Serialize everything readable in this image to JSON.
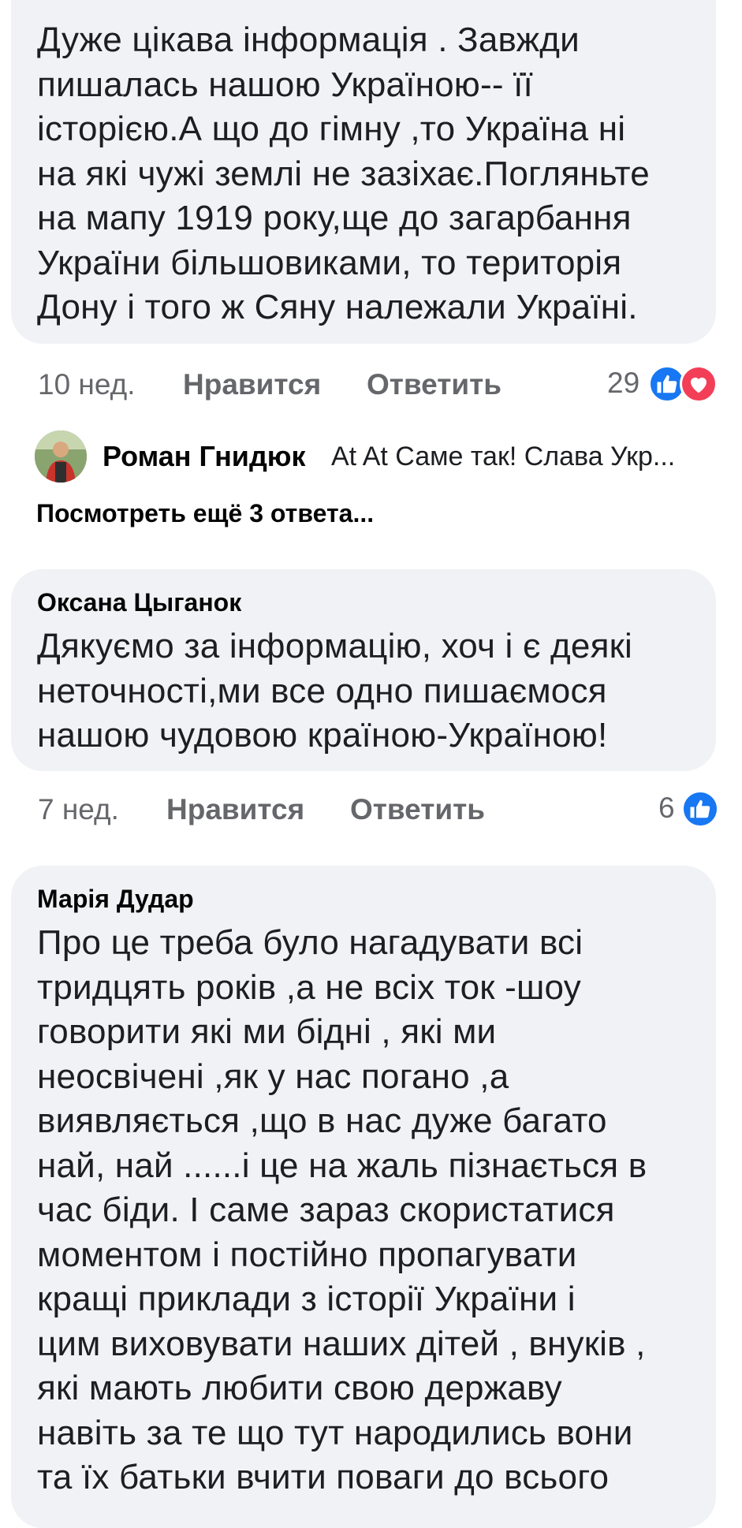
{
  "comment1": {
    "text_lines": [
      "Дуже цікава інформація . Завжди",
      "пишалась нашою Україною-- її",
      "історією.А що до гімну ,то Україна ні",
      "на які чужі землі не зазіхає.Погляньте",
      "на мапу 1919 року,ще до загарбання",
      "України більшовиками, то територія",
      "Дону і того ж Сяну належали Україні."
    ],
    "time": "10 нед.",
    "like_label": "Нравится",
    "reply_label": "Ответить",
    "reaction_count": "29",
    "reactions": [
      "like-icon",
      "love-icon"
    ]
  },
  "reply_preview": {
    "author": "Роман Гнидюк",
    "snippet": "At At Саме так! Слава Укр...",
    "more_label": "Посмотреть ещё 3 ответа..."
  },
  "comment2": {
    "author": "Оксана Цыганок",
    "text_lines": [
      "Дякуємо за інформацію, хоч і є деякі",
      "неточності,ми все одно  пишаємося",
      "нашою чудовою  країною-Україною!"
    ],
    "time": "7 нед.",
    "like_label": "Нравится",
    "reply_label": "Ответить",
    "reaction_count": "6",
    "reactions": [
      "like-icon"
    ]
  },
  "comment3": {
    "author": "Марія Дудар",
    "text_lines": [
      "Про це треба було нагадувати всі",
      "тридцять років ,а не всіх ток -шоу",
      "говорити які ми бідні , які ми",
      "неосвічені ,як у нас погано ,а",
      "виявляється  ,що в нас дуже багато",
      "най, най ......і це на жаль пізнається  в",
      "час біди. І саме зараз  скористатися",
      "моментом і  постійно пропагувати",
      "кращі приклади з історії України  і",
      "цим виховувати наших дітей , внуків ,",
      "які мають любити свою державу",
      "навіть за те що тут народились  вони",
      "та їх батьки вчити поваги до всього"
    ]
  },
  "colors": {
    "bubble": "#f0f2f5",
    "meta_text": "#65676b",
    "like_blue": "#1877f2",
    "love_red": "#f33e58"
  }
}
